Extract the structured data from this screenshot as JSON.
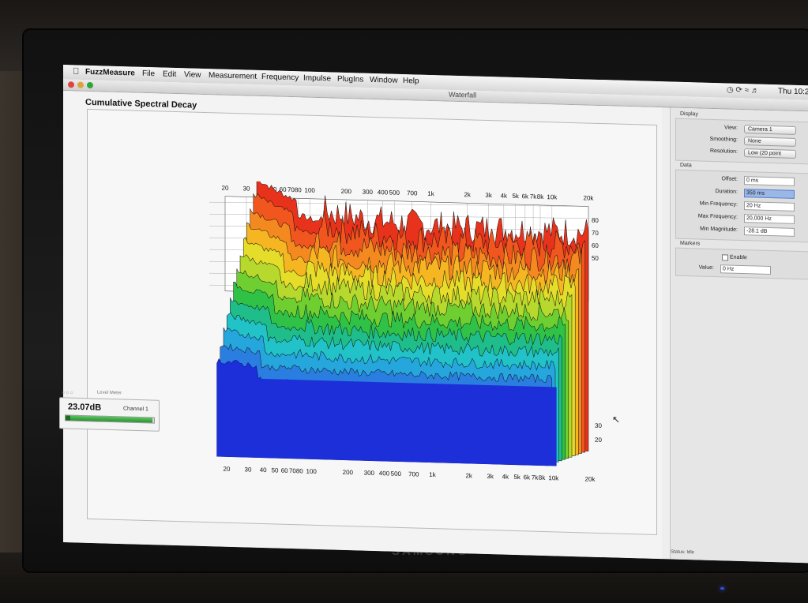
{
  "menubar": {
    "app_name": "FuzzMeasure",
    "items": [
      "File",
      "Edit",
      "View",
      "Measurement",
      "Frequency",
      "Impulse",
      "PlugIns",
      "Window",
      "Help"
    ],
    "clock": "Thu 10:2"
  },
  "window": {
    "title": "Waterfall"
  },
  "plot": {
    "title": "Cumulative Spectral Decay",
    "freq_labels_top": [
      "20",
      "30",
      "40",
      "50",
      "60",
      "70",
      "80",
      "100",
      "200",
      "300",
      "400",
      "500",
      "700",
      "1k",
      "2k",
      "3k",
      "4k",
      "5k",
      "6k",
      "7k",
      "8k",
      "10k",
      "20k"
    ],
    "freq_labels_bottom": [
      "20",
      "30",
      "40",
      "50",
      "60",
      "70",
      "80",
      "100",
      "200",
      "300",
      "400",
      "500",
      "700",
      "1k",
      "2k",
      "3k",
      "4k",
      "5k",
      "6k",
      "7k",
      "8k",
      "10k",
      "20k"
    ],
    "mag_labels": [
      "80",
      "70",
      "60",
      "50"
    ],
    "mag_labels_front": [
      "30",
      "20"
    ]
  },
  "sidebar": {
    "display": {
      "label": "Display",
      "view_label": "View:",
      "view_value": "Camera 1",
      "smoothing_label": "Smoothing:",
      "smoothing_value": "None",
      "resolution_label": "Resolution:",
      "resolution_value": "Low (20 point"
    },
    "data": {
      "label": "Data",
      "offset_label": "Offset:",
      "offset_value": "0 ms",
      "duration_label": "Duration:",
      "duration_value": "350 ms",
      "min_freq_label": "Min Frequency:",
      "min_freq_value": "20 Hz",
      "max_freq_label": "Max Frequency:",
      "max_freq_value": "20,000 Hz",
      "min_mag_label": "Min Magnitude:",
      "min_mag_value": "-28.1 dB"
    },
    "markers": {
      "label": "Markers",
      "enable_label": "Enable",
      "value_label": "Value:",
      "value_value": "0 Hz"
    },
    "status": "Status:   Idle"
  },
  "level_meter": {
    "title": "Level Meter",
    "value": "23.07dB",
    "channel": "Channel 1",
    "level_fraction": 0.98
  },
  "monitor": {
    "brand": "SAMSUNG"
  },
  "colors": {
    "waterfall_base": "#1c2fd8",
    "menu_text": "#111111",
    "field_selected": "#9ab7e8"
  }
}
